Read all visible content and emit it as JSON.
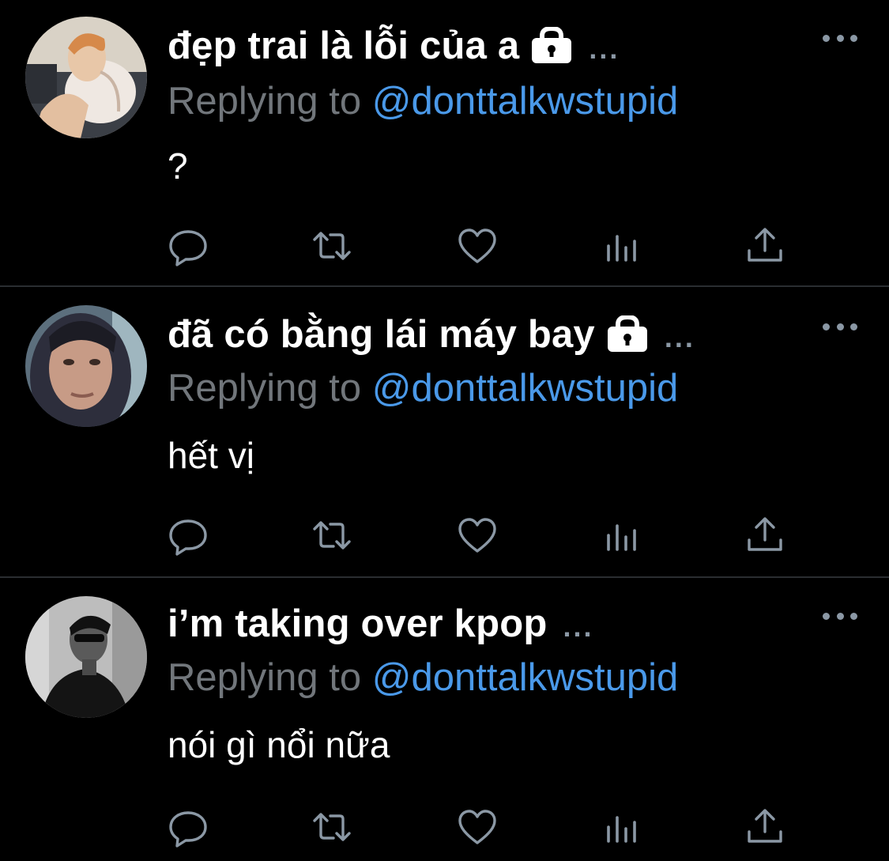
{
  "tweets": [
    {
      "display_name": "đẹp trai là lỗi của a",
      "locked": true,
      "ellipsis": "...",
      "reply_prefix": "Replying to ",
      "reply_handle": "@donttalkwstupid",
      "text": "?",
      "avatar_icon": "avatar-photo"
    },
    {
      "display_name": "đã có bằng lái máy bay",
      "locked": true,
      "ellipsis": "...",
      "reply_prefix": "Replying to ",
      "reply_handle": "@donttalkwstupid",
      "text": "hết vị",
      "avatar_icon": "avatar-photo"
    },
    {
      "display_name": "i’m taking over kpop",
      "locked": false,
      "ellipsis": "...",
      "reply_prefix": "Replying to ",
      "reply_handle": "@donttalkwstupid",
      "text": "nói gì nổi nữa",
      "avatar_icon": "avatar-photo"
    }
  ],
  "actions": [
    "reply-icon",
    "retweet-icon",
    "like-icon",
    "analytics-icon",
    "share-icon"
  ],
  "colors": {
    "background": "#000000",
    "secondary_text": "#71767b",
    "link": "#4a99e9",
    "icon": "#8b98a5",
    "divider": "#2a2d31"
  }
}
